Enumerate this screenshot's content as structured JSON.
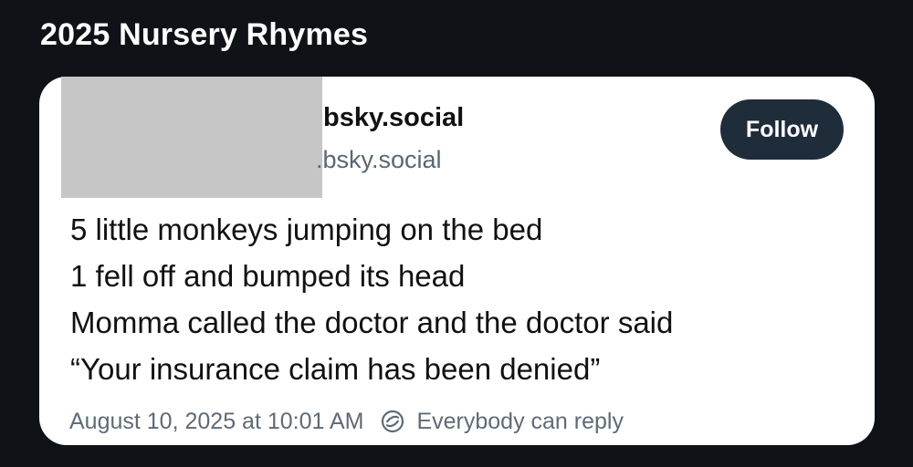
{
  "page": {
    "title": "2025 Nursery Rhymes"
  },
  "post": {
    "display_name": "bsky.social",
    "handle": ".bsky.social",
    "follow_label": "Follow",
    "lines": [
      "5 little monkeys jumping on the bed",
      "1 fell off and bumped its head",
      "Momma called the doctor and the doctor said",
      "“Your insurance claim has been denied”"
    ],
    "timestamp": "August 10, 2025 at 10:01 AM",
    "reply_setting": "Everybody can reply",
    "reply_icon": "reply-settings-icon"
  },
  "colors": {
    "background": "#0f1216",
    "card": "#ffffff",
    "follow_button": "#1f2c3a",
    "muted_text": "#5e6a76"
  }
}
